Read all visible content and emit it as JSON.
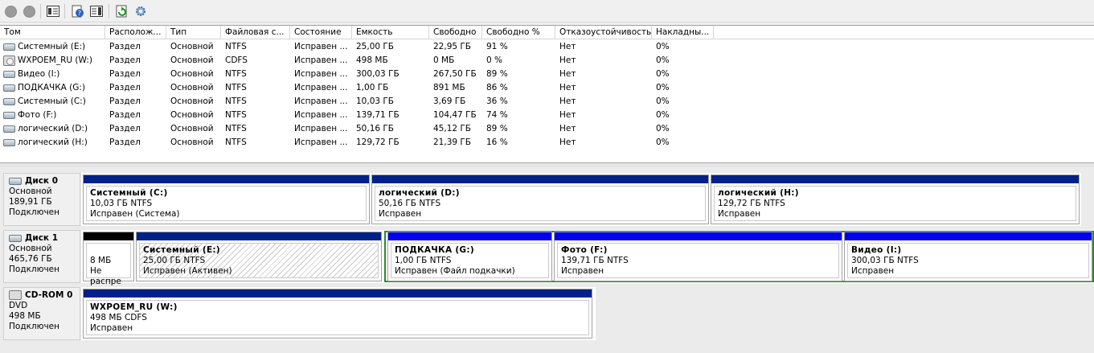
{
  "toolbar": {
    "icons": [
      "back-icon",
      "forward-icon",
      "show-pane-icon",
      "help-icon",
      "properties-icon",
      "refresh-icon",
      "settings-icon"
    ]
  },
  "volumes": {
    "columns": [
      "Том",
      "Располож...",
      "Тип",
      "Файловая с...",
      "Состояние",
      "Емкость",
      "Свободно",
      "Свободно %",
      "Отказоустойчивость",
      "Накладны..."
    ],
    "rows": [
      {
        "name": "Системный (E:)",
        "layout": "Раздел",
        "type": "Основной",
        "fs": "NTFS",
        "status": "Исправен ...",
        "capacity": "25,00 ГБ",
        "free": "22,95 ГБ",
        "free_pct": "91 %",
        "fault": "Нет",
        "overhead": "0%",
        "icon": "volume-icon"
      },
      {
        "name": "WXPOEM_RU (W:)",
        "layout": "Раздел",
        "type": "Основной",
        "fs": "CDFS",
        "status": "Исправен ...",
        "capacity": "498 МБ",
        "free": "0 МБ",
        "free_pct": "0 %",
        "fault": "Нет",
        "overhead": "0%",
        "icon": "cdrom-icon"
      },
      {
        "name": "Видео (I:)",
        "layout": "Раздел",
        "type": "Основной",
        "fs": "NTFS",
        "status": "Исправен ...",
        "capacity": "300,03 ГБ",
        "free": "267,50 ГБ",
        "free_pct": "89 %",
        "fault": "Нет",
        "overhead": "0%",
        "icon": "volume-icon"
      },
      {
        "name": "ПОДКАЧКА (G:)",
        "layout": "Раздел",
        "type": "Основной",
        "fs": "NTFS",
        "status": "Исправен ...",
        "capacity": "1,00 ГБ",
        "free": "891 МБ",
        "free_pct": "86 %",
        "fault": "Нет",
        "overhead": "0%",
        "icon": "volume-icon"
      },
      {
        "name": "Системный (C:)",
        "layout": "Раздел",
        "type": "Основной",
        "fs": "NTFS",
        "status": "Исправен ...",
        "capacity": "10,03 ГБ",
        "free": "3,69 ГБ",
        "free_pct": "36 %",
        "fault": "Нет",
        "overhead": "0%",
        "icon": "volume-icon"
      },
      {
        "name": "Фото (F:)",
        "layout": "Раздел",
        "type": "Основной",
        "fs": "NTFS",
        "status": "Исправен ...",
        "capacity": "139,71 ГБ",
        "free": "104,47 ГБ",
        "free_pct": "74 %",
        "fault": "Нет",
        "overhead": "0%",
        "icon": "volume-icon"
      },
      {
        "name": "логический (D:)",
        "layout": "Раздел",
        "type": "Основной",
        "fs": "NTFS",
        "status": "Исправен ...",
        "capacity": "50,16 ГБ",
        "free": "45,12 ГБ",
        "free_pct": "89 %",
        "fault": "Нет",
        "overhead": "0%",
        "icon": "volume-icon"
      },
      {
        "name": "логический (H:)",
        "layout": "Раздел",
        "type": "Основной",
        "fs": "NTFS",
        "status": "Исправен ...",
        "capacity": "129,72 ГБ",
        "free": "21,39 ГБ",
        "free_pct": "16 %",
        "fault": "Нет",
        "overhead": "0%",
        "icon": "volume-icon"
      }
    ]
  },
  "disks": [
    {
      "name": "Диск 0",
      "kind": "Основной",
      "size": "189,91 ГБ",
      "state": "Подключен",
      "icon": "disk-icon",
      "partitions": [
        {
          "name": "Системный  (C:)",
          "size": "10,03 ГБ NTFS",
          "status": "Исправен (Система)"
        },
        {
          "name": "логический  (D:)",
          "size": "50,16 ГБ NTFS",
          "status": "Исправен"
        },
        {
          "name": "логический  (H:)",
          "size": "129,72 ГБ NTFS",
          "status": "Исправен"
        }
      ]
    },
    {
      "name": "Диск 1",
      "kind": "Основной",
      "size": "465,76 ГБ",
      "state": "Подключен",
      "icon": "disk-icon",
      "partitions": [
        {
          "name": "",
          "size": "8 МБ",
          "status": "Не распре"
        },
        {
          "name": "Системный  (E:)",
          "size": "25,00 ГБ NTFS",
          "status": "Исправен (Активен)"
        },
        {
          "name": "ПОДКАЧКА  (G:)",
          "size": "1,00 ГБ NTFS",
          "status": "Исправен (Файл подкачки)"
        },
        {
          "name": "Фото  (F:)",
          "size": "139,71 ГБ NTFS",
          "status": "Исправен"
        },
        {
          "name": "Видео  (I:)",
          "size": "300,03 ГБ NTFS",
          "status": "Исправен"
        }
      ]
    },
    {
      "name": "CD-ROM 0",
      "kind": "DVD",
      "size": "498 МБ",
      "state": "Подключен",
      "icon": "cdrom-icon",
      "partitions": [
        {
          "name": "WXPOEM_RU  (W:)",
          "size": "498 МБ CDFS",
          "status": "Исправен"
        }
      ]
    }
  ],
  "colors": {
    "primary": "#002288",
    "logical": "#0000ee",
    "unallocated": "#000000",
    "extended": "#2b8a2b"
  }
}
